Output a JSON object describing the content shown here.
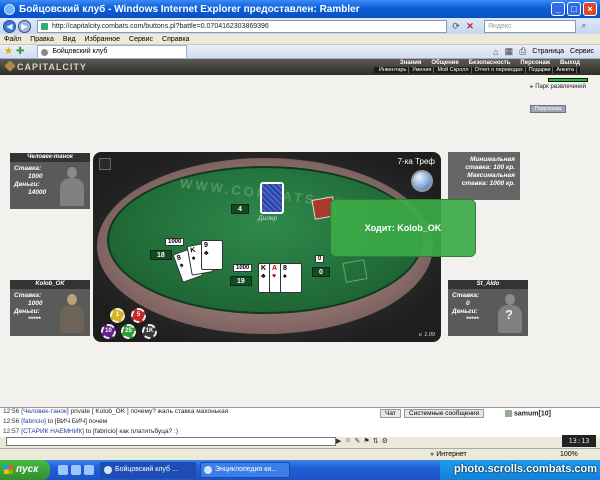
{
  "window": {
    "title": "Бойцовский клуб - Windows Internet Explorer предоставлен: Rambler",
    "buttons": [
      "_",
      "□",
      "×"
    ]
  },
  "address": {
    "url": "http://capitalcity.combats.com/buttons.pl?battle=0.0704162303869396",
    "search_placeholder": "Яндекс"
  },
  "menu": [
    "Файл",
    "Правка",
    "Вид",
    "Избранное",
    "Сервис",
    "Справка"
  ],
  "tab": {
    "label": "Бойцовский клуб"
  },
  "toolbar": {
    "page_label": "Страница",
    "service_label": "Сервис"
  },
  "game": {
    "logo": "CAPITALCITY",
    "nav_main": [
      "Знания",
      "Общение",
      "Безопасность",
      "Персонаж",
      "Выход"
    ],
    "nav_sub": [
      "Инвентарь",
      "Умения",
      "Мой Скролл",
      "Отчет о переводах",
      "Подарки",
      "Анкета"
    ],
    "park": "Парк развлечений",
    "hint": "Подсказка",
    "table": {
      "watermark": "WWW.COMBATS.RU",
      "game_type": "7-ка Треф",
      "version": "v. 1.09",
      "dealer_label": "Дилер",
      "dealer_score": "4",
      "player_bet": "1000",
      "player_score": "18",
      "bot_bet": "1000",
      "bot_score": "19",
      "zero_bet": "0",
      "zero_score": "0",
      "chips": [
        "1",
        "5",
        "10",
        "25",
        "1K"
      ]
    },
    "stake": {
      "min_label": "Минимальная",
      "min_value": "ставка: 100 кр.",
      "max_label": "Максимальная",
      "max_value": "ставка: 1000 кр."
    },
    "turn": "Ходит: Kolob_OK",
    "players": {
      "top_left": {
        "name": "Человек-танок",
        "stake_label": "Ставка:",
        "stake": "1000",
        "money_label": "Деньги:",
        "money": "14000"
      },
      "bottom_left": {
        "name": "Kolob_OK",
        "stake_label": "Ставка:",
        "stake": "1000",
        "money_label": "Деньги:",
        "money": "*****"
      },
      "bottom_right": {
        "name": "St_Aldo",
        "stake_label": "Ставка:",
        "stake": "0",
        "money_label": "Деньги:",
        "money": "*****"
      }
    }
  },
  "chat": {
    "lines": [
      {
        "time": "12:56",
        "user": "[Человек-танок]",
        "msg": "private [ Kolob_OK ] почему? жаль ставка махонькая"
      },
      {
        "time": "12:56",
        "user": "[fabricio]",
        "msg": "to [ВИЧ БИЧ] почем"
      },
      {
        "time": "12:57",
        "user": "[СТАРИК НАЕМНИК]",
        "msg": "to [fabricio] как платитьбуца? :)"
      }
    ],
    "tab_chat": "Чат",
    "tab_system": "Системные сообщения",
    "online_user": "samum[10]",
    "clock": "13:13"
  },
  "status": {
    "internet": "Интернет",
    "zoom": "100%"
  },
  "taskbar": {
    "start": "пуск",
    "buttons": [
      "Бойцовский клуб ...",
      "Энциклопедия ки..."
    ],
    "watermark": "photo.scrolls.combats.com"
  }
}
